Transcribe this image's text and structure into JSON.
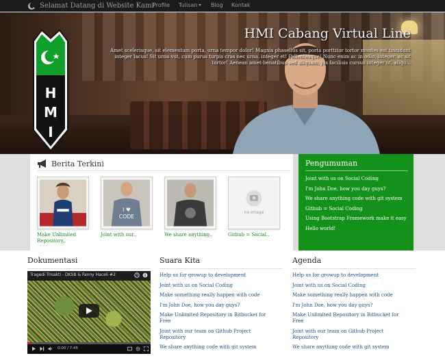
{
  "navbar": {
    "brand": "Selamat Datang di Website Kami",
    "items": [
      {
        "label": "Profile"
      },
      {
        "label": "Tulisan",
        "dropdown": true
      },
      {
        "label": "Blog"
      },
      {
        "label": "Kontak"
      }
    ]
  },
  "hero": {
    "title": "HMI Cabang Virtual Line",
    "text": "Amet scelerisque, sit elementum porta, urna tempor dolor! Magnis phasellus sit, porta porttitor tortor montes est tincidunt integer lacus! Sit urna vut, cum purus turpis cras nec urna, integer et! Pellentesque! Nunc enim ac in odio, integer, ac sit tortor! Aenean amet-benatibus sed aliquam, jus facilisis cursus integer ut, aliqu...",
    "logo_text": "HMI"
  },
  "berita": {
    "title": "Berita Terkini",
    "items": [
      {
        "caption": "Make Unlimited Repository..",
        "image": "person-photo"
      },
      {
        "caption": "Joint with our..",
        "image": "person-photo"
      },
      {
        "caption": "We share anything..",
        "image": "person-photo"
      },
      {
        "caption": "Github = Social..",
        "image": "no-image",
        "placeholder": "no-image"
      }
    ]
  },
  "pengumuman": {
    "title": "Pengumuman",
    "items": [
      "Joint with us on Social Coding",
      "I'm John Doe, how you day guys?",
      "We share anything code with git system",
      "Github = Social Coding",
      "Using Bootstrap Framework make it easy",
      "Hello world!"
    ]
  },
  "dokumentasi": {
    "title": "Dokumentasi",
    "video": {
      "title": "Tragedi Trisakti - DKSB & Fanny Haceli #2",
      "time": "0:00 / 7:45",
      "progress": 0.03
    }
  },
  "suara_kita": {
    "title": "Suara Kita",
    "items": [
      "Help us for growup to development",
      "Joint with us on Social Coding",
      "Make something really happen with code",
      "I'm John Doe, how you day guys?",
      "Make Unlimited Repository in Bitbucket for Free",
      "Joint with our team on Github Project Repository",
      "We share anything code with git system"
    ]
  },
  "agenda": {
    "title": "Agenda",
    "items": [
      "Help us for growup to development",
      "Joint with us on Social Coding",
      "Make something really happen with code",
      "I'm John Doe, how you day guys?",
      "Make Unlimited Repository in Bitbucket for Free",
      "Joint with our team on Github Project Repository",
      "We share anything code with git system"
    ]
  },
  "colors": {
    "navbar": "#1b1b1b",
    "accent_green": "#13911a",
    "link_green": "#1a8d1f",
    "link_blue": "#1a4f8a"
  }
}
